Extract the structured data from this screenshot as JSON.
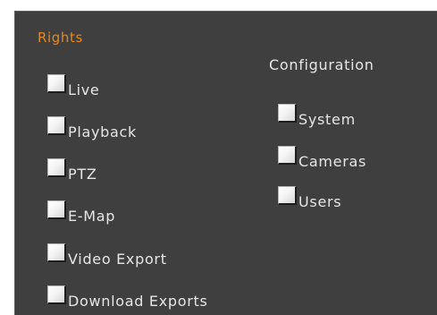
{
  "colors": {
    "panel_background": "#3f3f3f",
    "heading_accent": "#e8891a",
    "label_text": "#e6e6e6"
  },
  "rights": {
    "title": "Rights",
    "items": [
      {
        "label": "Live",
        "checked": false
      },
      {
        "label": "Playback",
        "checked": false
      },
      {
        "label": "PTZ",
        "checked": false
      },
      {
        "label": "E-Map",
        "checked": false
      },
      {
        "label": "Video Export",
        "checked": false
      },
      {
        "label": "Download Exports",
        "checked": false
      }
    ]
  },
  "configuration": {
    "title": "Configuration",
    "items": [
      {
        "label": "System",
        "checked": false
      },
      {
        "label": "Cameras",
        "checked": false
      },
      {
        "label": "Users",
        "checked": false
      }
    ]
  }
}
